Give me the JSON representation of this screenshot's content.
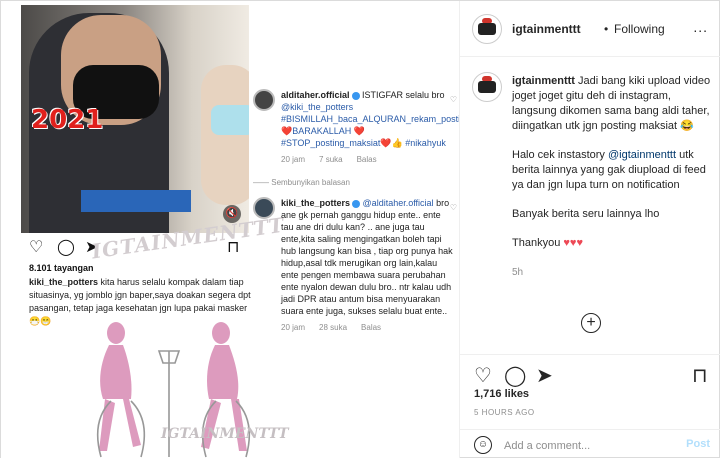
{
  "media": {
    "views": "8.101 tayangan",
    "caption_user": "kiki_the_potters",
    "caption_text": " kita harus selalu kompak dalam tiap situasinya, yg jomblo jgn baper,saya doakan segera dpt pasangan, tetap jaga kesehatan jgn lupa pakai masker 😷😁",
    "video_badge": "2021",
    "watermark": "IGTAINMENTTT",
    "comments": [
      {
        "user": "alditaher.official",
        "text": " ISTIGFAR selalu bro ",
        "mention": "@kiki_the_potters",
        "tags": " #BISMILLAH_baca_ALQURAN_rekam_posting❤️BARAKALLAH ❤️ #STOP_posting_maksiat❤️👍 #nikahyuk",
        "time": "20 jam",
        "likes": "7 suka",
        "reply": "Balas"
      }
    ],
    "hide_replies": "Sembunyikan balasan",
    "reply": {
      "user": "kiki_the_potters",
      "mention": "@alditaher.official",
      "text": " bro ane gk pernah ganggu hidup ente.. ente tau ane dri dulu kan? .. ane juga tau ente,kita saling mengingatkan boleh tapi hub langsung kan bisa , tiap org punya hak hidup,asal tdk merugikan org lain,kalau ente pengen membawa suara perubahan ente nyalon dewan dulu bro.. ntr kalau udh jadi DPR atau antum bisa menyuarakan suara ente juga, sukses selalu buat ente..",
      "time": "20 jam",
      "likes": "28 suka",
      "reply": "Balas"
    }
  },
  "header": {
    "username": "igtainmenttt",
    "separator": "•",
    "follow_status": "Following",
    "more": "..."
  },
  "post": {
    "username": "igtainmenttt",
    "caption_p1": " Jadi bang kiki upload video joget joget gitu deh di instagram, langsung dikomen sama bang aldi taher, diingatkan utk jgn posting maksiat 😂",
    "caption_p2_a": "Halo cek instastory ",
    "caption_p2_mention": "@igtainmenttt",
    "caption_p2_b": " utk berita lainnya yang gak diupload di feed ya dan jgn lupa turn on notification",
    "caption_p3": "Banyak berita seru lainnya lho",
    "caption_p4": "Thankyou ",
    "caption_hearts": "♥♥♥",
    "time": "5h"
  },
  "actions": {
    "likes": "1,716 likes",
    "ago": "5 HOURS AGO",
    "comment_placeholder": "Add a comment...",
    "post_label": "Post"
  },
  "colors": {
    "link": "#00376b",
    "heart": "#ed4956",
    "post_disabled": "#b2dffc"
  }
}
